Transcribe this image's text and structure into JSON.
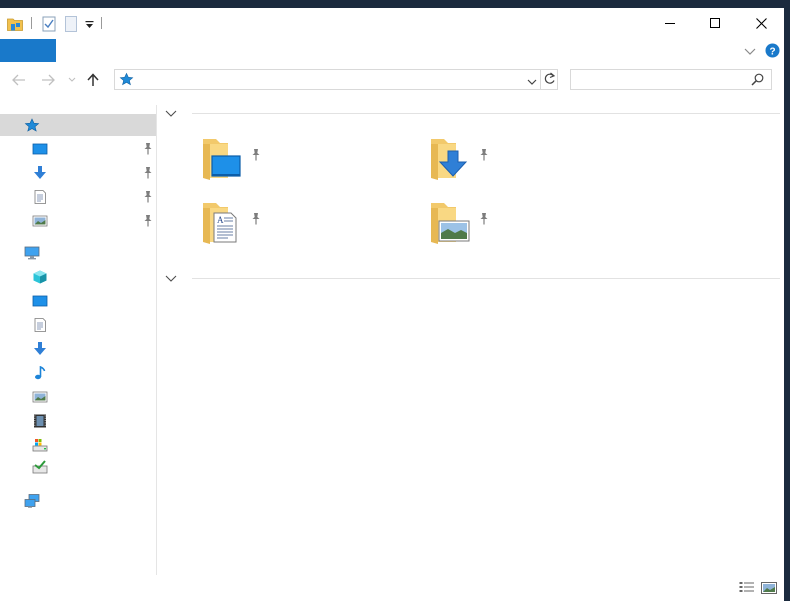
{
  "window": {
    "title": ""
  },
  "quick_access_toolbar": {
    "icons": [
      "folder-icon",
      "properties-icon",
      "new-folder-icon",
      "customize-dropdown-icon"
    ]
  },
  "window_controls": [
    "minimize",
    "maximize",
    "close"
  ],
  "ribbon": {
    "file_tab_color": "#1979ca",
    "help_color": "#1979ca"
  },
  "address_bar": {
    "path": "",
    "location_icon": "quick-access-icon"
  },
  "search": {
    "placeholder": ""
  },
  "nav_pane": {
    "quick_access": {
      "icon": "quick-access-star-icon",
      "items": [
        {
          "icon": "desktop-icon",
          "pinned": true
        },
        {
          "icon": "downloads-icon",
          "pinned": true
        },
        {
          "icon": "documents-icon",
          "pinned": true
        },
        {
          "icon": "pictures-icon",
          "pinned": true
        }
      ]
    },
    "this_pc": {
      "icon": "this-pc-icon",
      "items": [
        {
          "icon": "3d-objects-icon"
        },
        {
          "icon": "desktop-icon"
        },
        {
          "icon": "documents-icon"
        },
        {
          "icon": "downloads-icon"
        },
        {
          "icon": "music-icon"
        },
        {
          "icon": "pictures-icon"
        },
        {
          "icon": "videos-icon"
        },
        {
          "icon": "local-disk-icon"
        },
        {
          "icon": "dvd-drive-icon"
        }
      ]
    },
    "network": {
      "icon": "network-icon"
    }
  },
  "content": {
    "groups": [
      {
        "header": "",
        "tiles": [
          {
            "icon": "desktop-folder-icon",
            "pinned": true
          },
          {
            "icon": "downloads-folder-icon",
            "pinned": true
          },
          {
            "icon": "documents-folder-icon",
            "pinned": true
          },
          {
            "icon": "pictures-folder-icon",
            "pinned": true
          }
        ]
      },
      {
        "header": "",
        "tiles": []
      }
    ]
  },
  "status_bar": {
    "views": [
      "details-view-icon",
      "large-icons-view-icon"
    ]
  }
}
